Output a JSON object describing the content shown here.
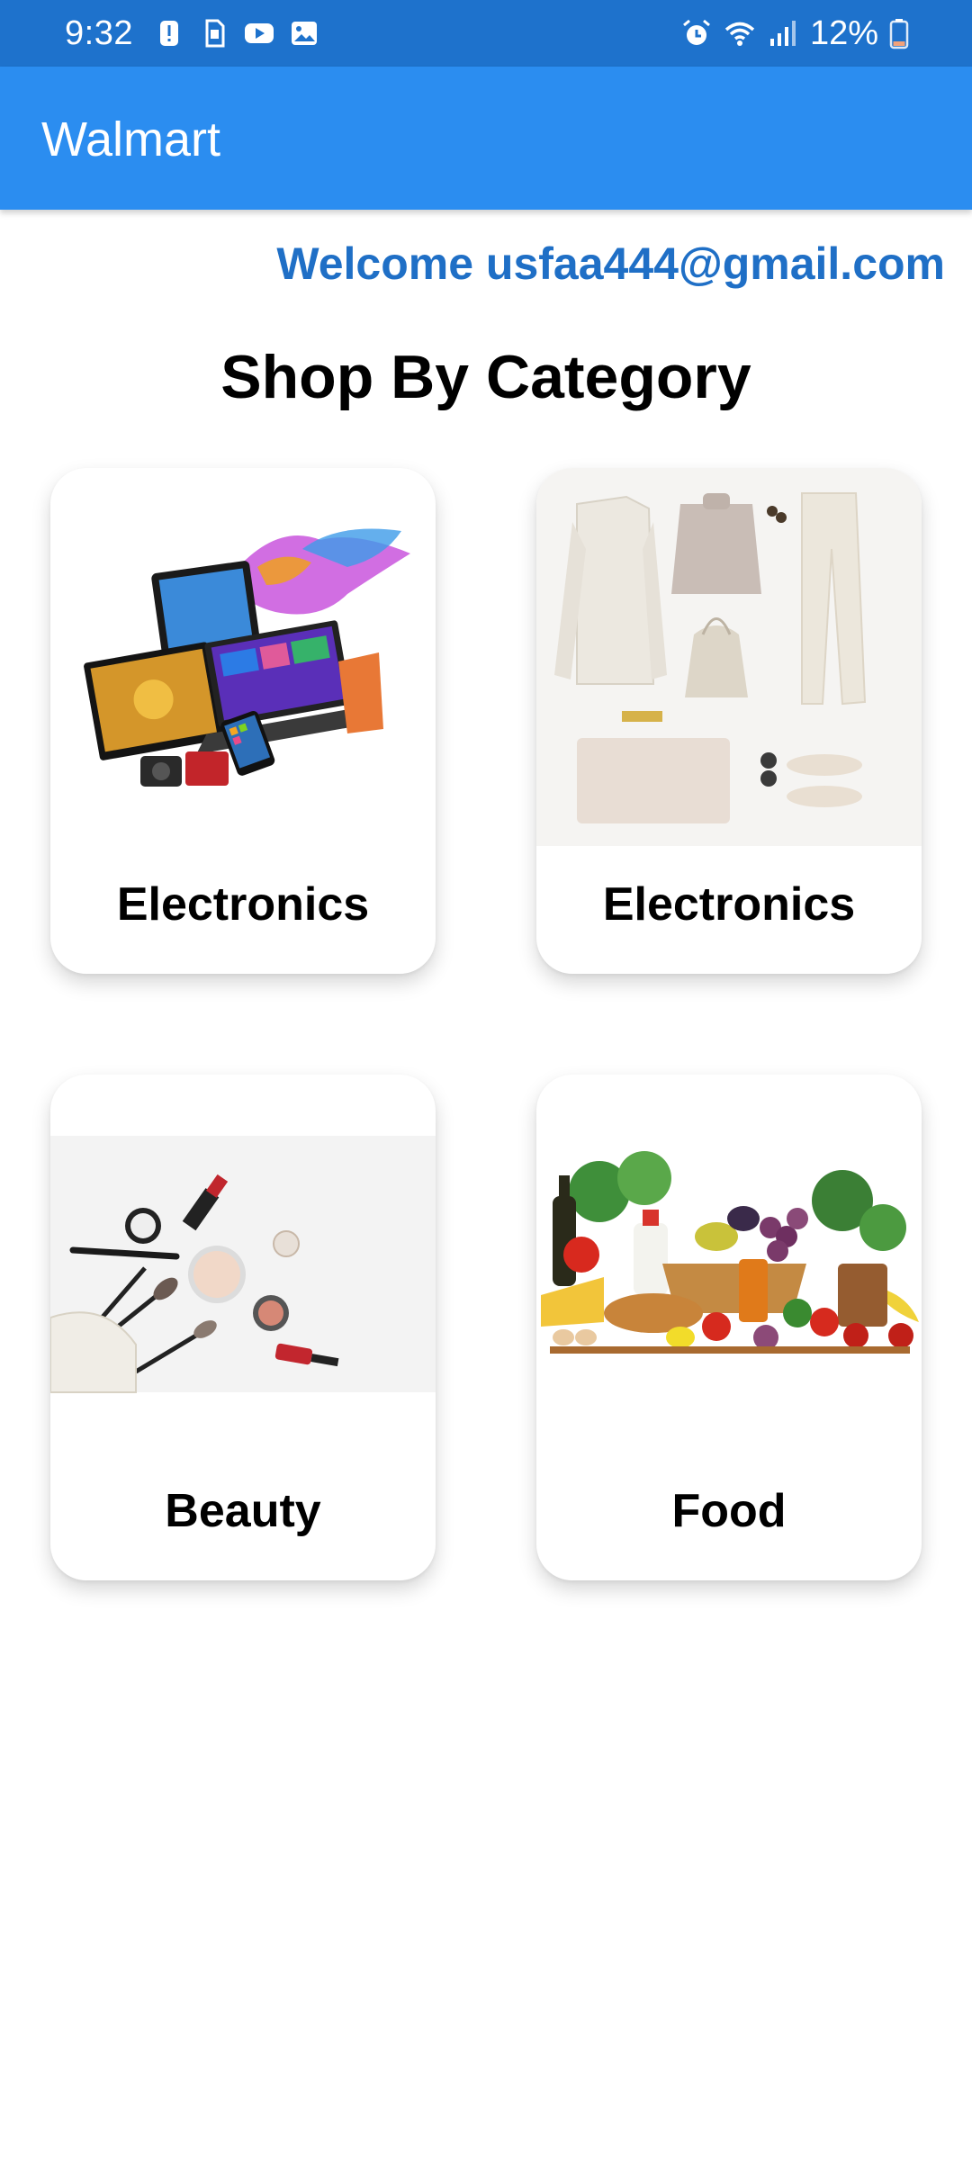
{
  "status_bar": {
    "time": "9:32",
    "battery_percent": "12%",
    "left_icons": [
      "alert-icon",
      "sim-icon",
      "youtube-icon",
      "gallery-icon"
    ],
    "right_icons": [
      "alarm-icon",
      "wifi-icon",
      "signal-icon",
      "battery-icon"
    ]
  },
  "app_bar": {
    "title": "Walmart",
    "color": "#2b8df0"
  },
  "welcome_text": "Welcome usfaa444@gmail.com",
  "section_title": "Shop By Category",
  "categories": [
    {
      "label": "Electronics",
      "image": "electronics-image"
    },
    {
      "label": "Electronics",
      "image": "fashion-image"
    },
    {
      "label": "Beauty",
      "image": "beauty-image"
    },
    {
      "label": "Food",
      "image": "food-image"
    }
  ],
  "colors": {
    "status_bar": "#1e72cc",
    "accent": "#2b8df0",
    "welcome": "#1f6fc6"
  }
}
